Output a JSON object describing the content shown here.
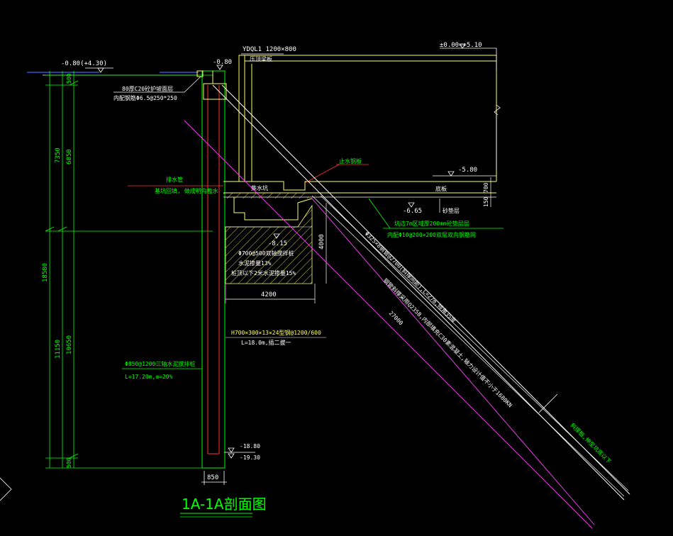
{
  "drawing": {
    "title": "1A-1A剖面图",
    "colors": {
      "background": "#000000",
      "dim": "#00ff00",
      "text_green": "#00ff00",
      "text_white": "#ffffff",
      "yellow": "#ffff66",
      "magenta": "#ff44ff",
      "cyan": "#33cccc",
      "red": "#ff3333",
      "blue": "#3366ff"
    },
    "elevations": {
      "top_left": "-0.80(+4.30)",
      "pile_cap_top": "-0.80",
      "ground_floor": "±0.00=+5.10",
      "basement_floor": "-5.80",
      "pit_bottom": "-6.65",
      "grout_bottom": "-8.15",
      "pile_tip_1": "-18.80",
      "pile_tip_2": "-19.30"
    },
    "left_dimensions": {
      "total": "18580",
      "upper": "7350",
      "lower": "11150",
      "seg_a": "500",
      "seg_b": "6850",
      "seg_c": "10650",
      "seg_d": "500"
    },
    "dims": {
      "pile_width": "850",
      "grout_width": "4200",
      "grout_depth": "4000",
      "slab_700": "700",
      "slab_150": "150",
      "anchor_length": "27000"
    },
    "labels": {
      "beam": "YDQL1 1200×800",
      "slab_top": "压顶梁板",
      "surface": "80厚C20砼护坡面层",
      "surface_mesh": "内配钢筋Φ6.5@250*250",
      "drain": "排水管",
      "drain_note": "基坑回填, 做成明沟截水",
      "water_stop_steel": "止水钢板",
      "sump": "集水坑",
      "base_plate": "底板",
      "cushion": "砂垫层",
      "pile_cushion": "坑边7m区域厚200mm砼垫层层",
      "pile_mesh": "内配Φ10@200×200双层双向钢筋网",
      "grout_pile": "Φ700@500双轴搅拌桩",
      "cement_1": "水泥掺量13%",
      "cement_2": "桩顶以下2米水泥掺量15%",
      "h_steel": "H700×300×13×24型钢@1200/600",
      "h_steel_len": "L=18.0m,插二拔一",
      "triaxial": "Φ850@1200三轴水泥搅拌桩",
      "triaxial_len": "L=17.20m,α=20%",
      "anchor_spec": "Φ325×8钢管@2700(斜撑间距),L=27m,倾角35度",
      "anchor_note": "钢管斜撑采用Q235B,内部填充C30素混凝土,轴力设计值不小于1680KN",
      "anchor_end": "斜撑桩,伸至坑底以下"
    }
  }
}
